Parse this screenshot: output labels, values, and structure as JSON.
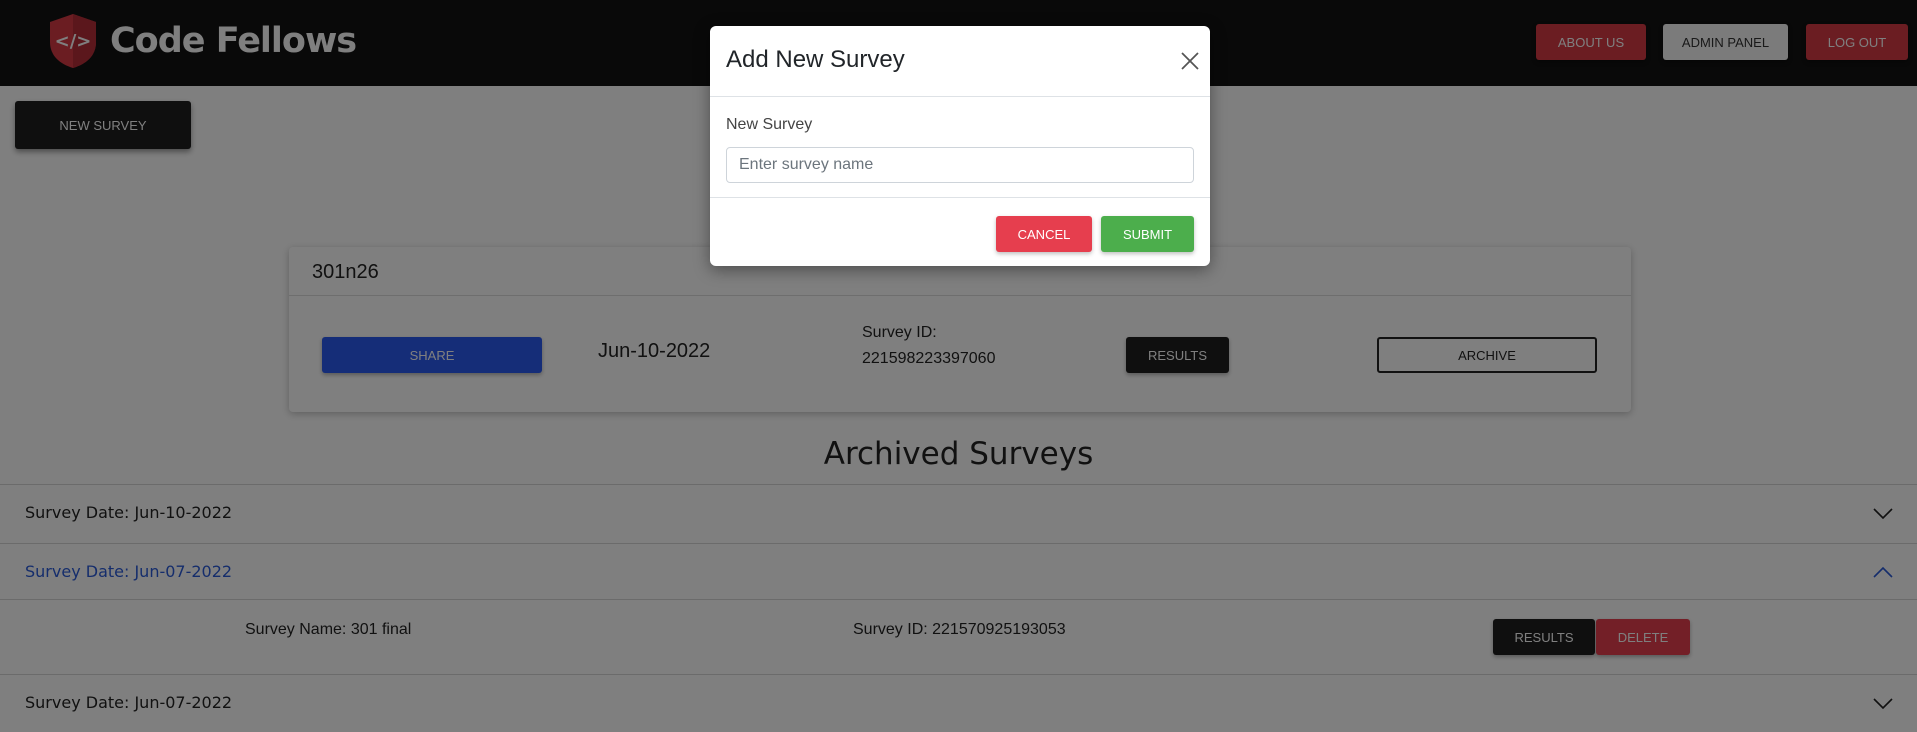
{
  "header": {
    "brand": "Code Fellows",
    "nav": {
      "about_label": "ABOUT US",
      "admin_label": "ADMIN PANEL",
      "logout_label": "LOG OUT"
    }
  },
  "toolbar": {
    "new_survey_label": "NEW SURVEY"
  },
  "active_survey": {
    "name": "301n26",
    "share_label": "SHARE",
    "date": "Jun-10-2022",
    "id_label": "Survey ID:",
    "id_value": "221598223397060",
    "results_label": "RESULTS",
    "archive_label": "ARCHIVE"
  },
  "archived": {
    "title": "Archived Surveys",
    "items": [
      {
        "label": "Survey Date: Jun-10-2022",
        "expanded": false
      },
      {
        "label": "Survey Date: Jun-07-2022",
        "expanded": true,
        "detail": {
          "name_text": "Survey Name: 301 final",
          "id_text": "Survey ID: 221570925193053",
          "results_label": "RESULTS",
          "delete_label": "DELETE"
        }
      },
      {
        "label": "Survey Date: Jun-07-2022",
        "expanded": false
      }
    ]
  },
  "modal": {
    "title": "Add New Survey",
    "field_label": "New Survey",
    "field_placeholder": "Enter survey name",
    "field_value": "",
    "cancel_label": "CANCEL",
    "submit_label": "SUBMIT"
  },
  "colors": {
    "brand_red": "#d63a45",
    "header_bg": "#121212",
    "share_blue": "#2a5bf0",
    "submit_green": "#4cae4c",
    "link_blue": "#2a5bd8"
  },
  "icons": {
    "logo": "code-shield-icon",
    "close": "close-icon",
    "expand": "chevron-down-icon",
    "collapse": "chevron-up-icon"
  }
}
